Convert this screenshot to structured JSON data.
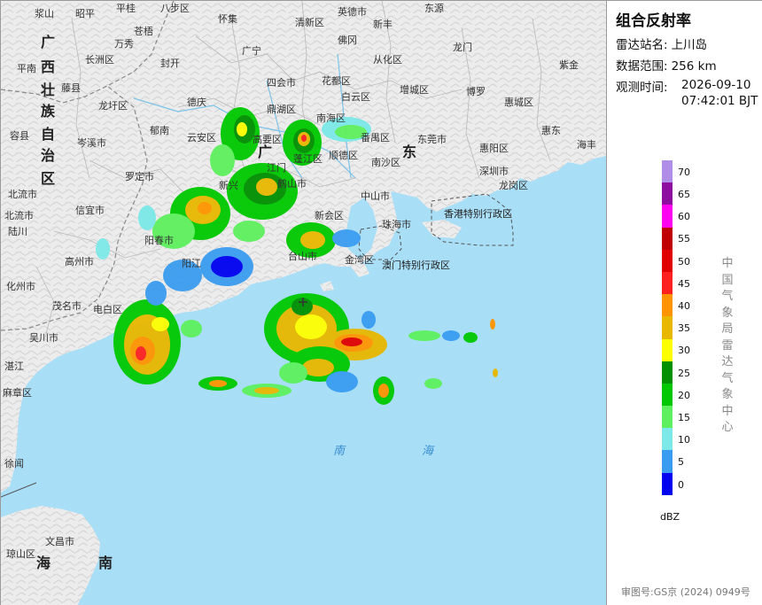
{
  "panel": {
    "title": "组合反射率",
    "station_key": "雷达站名:",
    "station_value": "上川岛",
    "range_key": "数据范围:",
    "range_value": "256 km",
    "time_key": "观测时间:",
    "time_date": "2026-09-10",
    "time_clock": "07:42:01 BJT",
    "agency": "中国气象局雷达气象中心",
    "unit": "dBZ",
    "approval": "审图号:GS京 (2024) 0949号"
  },
  "legend": {
    "ticks": [
      "70",
      "65",
      "60",
      "55",
      "50",
      "45",
      "40",
      "35",
      "30",
      "25",
      "20",
      "15",
      "10",
      "5",
      "0"
    ],
    "colors": [
      "#b08ee8",
      "#8e0da0",
      "#ff00f0",
      "#c00000",
      "#e00000",
      "#ff2020",
      "#ff9400",
      "#e8b800",
      "#ffff00",
      "#009000",
      "#00c800",
      "#5ef05e",
      "#7ce8e8",
      "#3a9cf0",
      "#0000f0"
    ]
  },
  "map": {
    "cities": {
      "c01": "浆山",
      "c02": "昭平",
      "c03": "平桂",
      "c04": "八步区",
      "c05": "怀集",
      "c06": "英德市",
      "c07": "新丰",
      "c08": "东源",
      "c09": "苍梧",
      "c10": "万秀",
      "c11": "长洲区",
      "c12": "封开",
      "c13": "广宁",
      "c14": "清新区",
      "c15": "佛冈",
      "c16": "从化区",
      "c17": "龙门",
      "c18": "紫金",
      "c19": "平南",
      "c20": "藤县",
      "c21": "德庆",
      "c22": "四会市",
      "c23": "花都区",
      "c24": "增城区",
      "c25": "博罗",
      "c26": "惠城区",
      "c27": "惠东",
      "c28": "容县",
      "c29": "龙圩区",
      "c30": "郁南",
      "c31": "鼎湖区",
      "c32": "南海区",
      "c33": "白云区",
      "c34": "岑溪市",
      "c35": "云安区",
      "c36": "高要区",
      "c37": "顺德区",
      "c38": "番禺区",
      "c39": "东莞市",
      "c40": "惠阳区",
      "c41": "海丰",
      "c42": "北流市",
      "c43": "罗定市",
      "c44": "新兴",
      "c45": "江门",
      "c46": "蓬江区",
      "c47": "南沙区",
      "c48": "深圳市",
      "c49": "龙岗区",
      "c50": "信宜市",
      "c51": "鹤山市",
      "c52": "中山市",
      "c53": "新会区",
      "c54": "香港特别行政区",
      "c55": "阳春市",
      "c56": "台山市",
      "c57": "金湾区",
      "c58": "澳门特别行政区",
      "c59": "高州市",
      "c60": "化州市",
      "c61": "电白区",
      "c62": "茂名市",
      "c63": "吴川市",
      "c64": "湛江",
      "c65": "麻章区",
      "c66": "徐闻",
      "c67": "文昌市",
      "c68": "琼山区",
      "c69": "北流市",
      "c70": "陆川",
      "c71": "珠海市",
      "c72": "阳江"
    },
    "provinces": {
      "gx": "广西壮族自治区",
      "gd1": "广",
      "gd2": "东",
      "hainan": "海南"
    },
    "sea_label": "南 海"
  }
}
